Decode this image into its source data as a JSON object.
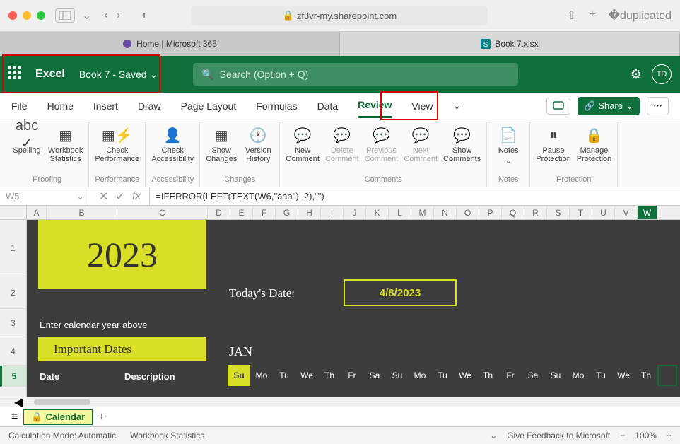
{
  "browser": {
    "url": "zf3vr-my.sharepoint.com",
    "tabs": [
      {
        "label": "Home | Microsoft 365"
      },
      {
        "label": "Book 7.xlsx"
      }
    ]
  },
  "header": {
    "app": "Excel",
    "doc": "Book 7 - Saved",
    "search_placeholder": "Search (Option + Q)",
    "avatar": "TD"
  },
  "ribbon_tabs": [
    "File",
    "Home",
    "Insert",
    "Draw",
    "Page Layout",
    "Formulas",
    "Data",
    "Review",
    "View"
  ],
  "active_tab": "Review",
  "share_label": "Share",
  "ribbon_groups": {
    "proofing": {
      "label": "Proofing",
      "items": [
        "Spelling",
        "Workbook\nStatistics"
      ]
    },
    "performance": {
      "label": "Performance",
      "items": [
        "Check\nPerformance"
      ]
    },
    "accessibility": {
      "label": "Accessibility",
      "items": [
        "Check\nAccessibility"
      ]
    },
    "changes": {
      "label": "Changes",
      "items": [
        "Show\nChanges",
        "Version\nHistory"
      ]
    },
    "comments": {
      "label": "Comments",
      "items": [
        "New\nComment",
        "Delete\nComment",
        "Previous\nComment",
        "Next\nComment",
        "Show\nComments"
      ]
    },
    "notes": {
      "label": "Notes",
      "items": [
        "Notes"
      ]
    },
    "protection": {
      "label": "Protection",
      "items": [
        "Pause\nProtection",
        "Manage\nProtection"
      ]
    }
  },
  "formula_bar": {
    "cell": "W5",
    "formula": "=IFERROR(LEFT(TEXT(W6,\"aaa\"), 2),\"\")"
  },
  "columns": [
    "A",
    "B",
    "C",
    "D",
    "E",
    "F",
    "G",
    "H",
    "I",
    "J",
    "K",
    "L",
    "M",
    "N",
    "O",
    "P",
    "Q",
    "R",
    "S",
    "T",
    "U",
    "V",
    "W"
  ],
  "selected_col": "W",
  "rows": [
    1,
    2,
    3,
    4,
    5
  ],
  "selected_row": 5,
  "sheet": {
    "year": "2023",
    "today_label": "Today's Date:",
    "today_date": "4/8/2023",
    "enter_year": "Enter calendar year above",
    "important_dates": "Important Dates",
    "month": "JAN",
    "date_hdr": "Date",
    "desc_hdr": "Description",
    "days": [
      "Su",
      "Mo",
      "Tu",
      "We",
      "Th",
      "Fr",
      "Sa",
      "Su",
      "Mo",
      "Tu",
      "We",
      "Th",
      "Fr",
      "Sa",
      "Su",
      "Mo",
      "Tu",
      "We",
      "Th"
    ]
  },
  "sheet_tab": "Calendar",
  "status": {
    "calc": "Calculation Mode: Automatic",
    "stats": "Workbook Statistics",
    "feedback": "Give Feedback to Microsoft",
    "zoom": "100%"
  }
}
